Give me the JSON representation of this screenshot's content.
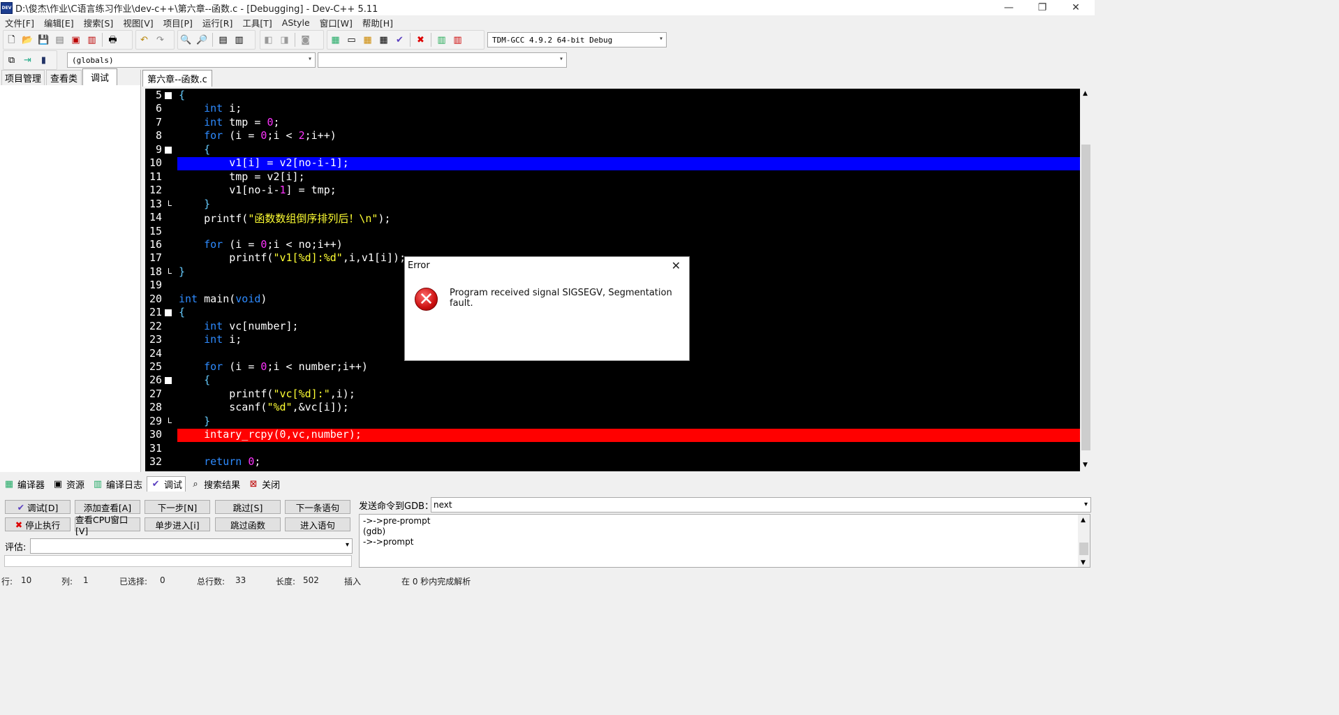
{
  "window": {
    "title": "D:\\俊杰\\作业\\C语言练习作业\\dev-c++\\第六章--函数.c - [Debugging] - Dev-C++ 5.11",
    "icon_label": "DEV",
    "min_glyph": "—",
    "restore_glyph": "❐",
    "close_glyph": "✕"
  },
  "menu": [
    "文件[F]",
    "编辑[E]",
    "搜索[S]",
    "视图[V]",
    "项目[P]",
    "运行[R]",
    "工具[T]",
    "AStyle",
    "窗口[W]",
    "帮助[H]"
  ],
  "toolbar": {
    "compiler_select": "TDM-GCC 4.9.2 64-bit Debug",
    "scope_select": "(globals)",
    "function_select": ""
  },
  "left_panel": {
    "tabs": [
      "项目管理",
      "查看类",
      "调试"
    ],
    "active_tab": "调试"
  },
  "editor": {
    "file_tab": "第六章--函数.c",
    "highlight_colors": {
      "current_line": "#0000ff",
      "error_line": "#ff0000"
    },
    "lines": [
      {
        "n": "5",
        "fold": "box",
        "html": "<span class=\"sym\">{</span>"
      },
      {
        "n": "6",
        "fold": "",
        "html": "    <span class=\"kw\">int</span> i;"
      },
      {
        "n": "7",
        "fold": "",
        "html": "    <span class=\"kw\">int</span> tmp = <span class=\"num\">0</span>;"
      },
      {
        "n": "8",
        "fold": "",
        "html": "    <span class=\"kw\">for</span> (i = <span class=\"num\">0</span>;i &lt; <span class=\"num\">2</span>;i++)"
      },
      {
        "n": "9",
        "fold": "box",
        "html": "    <span class=\"sym\">{</span>"
      },
      {
        "n": "10",
        "fold": "",
        "html": "        v1[i] = v2[no-i-1];",
        "hl": "current"
      },
      {
        "n": "11",
        "fold": "",
        "html": "        tmp = v2[i];"
      },
      {
        "n": "12",
        "fold": "",
        "html": "        v1[no-i-<span class=\"num\">1</span>] = tmp;"
      },
      {
        "n": "13",
        "fold": "end",
        "html": "    <span class=\"sym\">}</span>"
      },
      {
        "n": "14",
        "fold": "",
        "html": "    printf(<span class=\"str\">\"函数数组倒序排列后！\\n\"</span>);"
      },
      {
        "n": "15",
        "fold": "",
        "html": ""
      },
      {
        "n": "16",
        "fold": "",
        "html": "    <span class=\"kw\">for</span> (i = <span class=\"num\">0</span>;i &lt; no;i++)"
      },
      {
        "n": "17",
        "fold": "",
        "html": "        printf(<span class=\"str\">\"v1[%d]:%d\"</span>,i,v1[i]);"
      },
      {
        "n": "18",
        "fold": "end",
        "html": "<span class=\"sym\">}</span>"
      },
      {
        "n": "19",
        "fold": "",
        "html": ""
      },
      {
        "n": "20",
        "fold": "",
        "html": "<span class=\"kw\">int</span> main(<span class=\"kw\">void</span>)"
      },
      {
        "n": "21",
        "fold": "box",
        "html": "<span class=\"sym\">{</span>"
      },
      {
        "n": "22",
        "fold": "",
        "html": "    <span class=\"kw\">int</span> vc[number];"
      },
      {
        "n": "23",
        "fold": "",
        "html": "    <span class=\"kw\">int</span> i;"
      },
      {
        "n": "24",
        "fold": "",
        "html": ""
      },
      {
        "n": "25",
        "fold": "",
        "html": "    <span class=\"kw\">for</span> (i = <span class=\"num\">0</span>;i &lt; number;i++)"
      },
      {
        "n": "26",
        "fold": "box",
        "html": "    <span class=\"sym\">{</span>"
      },
      {
        "n": "27",
        "fold": "",
        "html": "        printf(<span class=\"str\">\"vc[%d]:\"</span>,i);"
      },
      {
        "n": "28",
        "fold": "",
        "html": "        scanf(<span class=\"str\">\"%d\"</span>,&amp;vc[i]);"
      },
      {
        "n": "29",
        "fold": "end",
        "html": "    <span class=\"sym\">}</span>"
      },
      {
        "n": "30",
        "fold": "",
        "html": "    intary_rcpy(0,vc,number);",
        "hl": "error"
      },
      {
        "n": "31",
        "fold": "",
        "html": ""
      },
      {
        "n": "32",
        "fold": "",
        "html": "    <span class=\"kw\">return</span> <span class=\"num\">0</span>;"
      }
    ]
  },
  "dialog": {
    "title": "Error",
    "message": "Program received signal SIGSEGV, Segmentation fault.",
    "close_glyph": "✕",
    "icon_glyph": "✕"
  },
  "bottom_tabs": [
    {
      "label": "编译器",
      "icon": "grid-icon",
      "glyph": "▦"
    },
    {
      "label": "资源",
      "icon": "resource-icon",
      "glyph": "▣"
    },
    {
      "label": "编译日志",
      "icon": "chart-icon",
      "glyph": "▥"
    },
    {
      "label": "调试",
      "icon": "check-icon",
      "glyph": "✔",
      "active": true
    },
    {
      "label": "搜索结果",
      "icon": "search-icon",
      "glyph": "⌕"
    },
    {
      "label": "关闭",
      "icon": "close-icon",
      "glyph": "⊠"
    }
  ],
  "debug": {
    "buttons_row1": [
      "调试[D]",
      "添加查看[A]",
      "下一步[N]",
      "跳过[S]",
      "下一条语句"
    ],
    "buttons_row2": [
      "停止执行",
      "查看CPU窗口[V]",
      "单步进入[i]",
      "跳过函数",
      "进入语句"
    ],
    "eval_label": "评估:",
    "eval_value": "",
    "gdb_label": "发送命令到GDB：",
    "gdb_command": "next",
    "gdb_output": [
      "->->pre-prompt",
      "(gdb)",
      "->->prompt"
    ]
  },
  "status": {
    "line_label": "行:",
    "line": "10",
    "col_label": "列:",
    "col": "1",
    "sel_label": "已选择:",
    "sel": "0",
    "total_label": "总行数:",
    "total": "33",
    "len_label": "长度:",
    "len": "502",
    "mode": "插入",
    "parse": "在 0 秒内完成解析"
  }
}
